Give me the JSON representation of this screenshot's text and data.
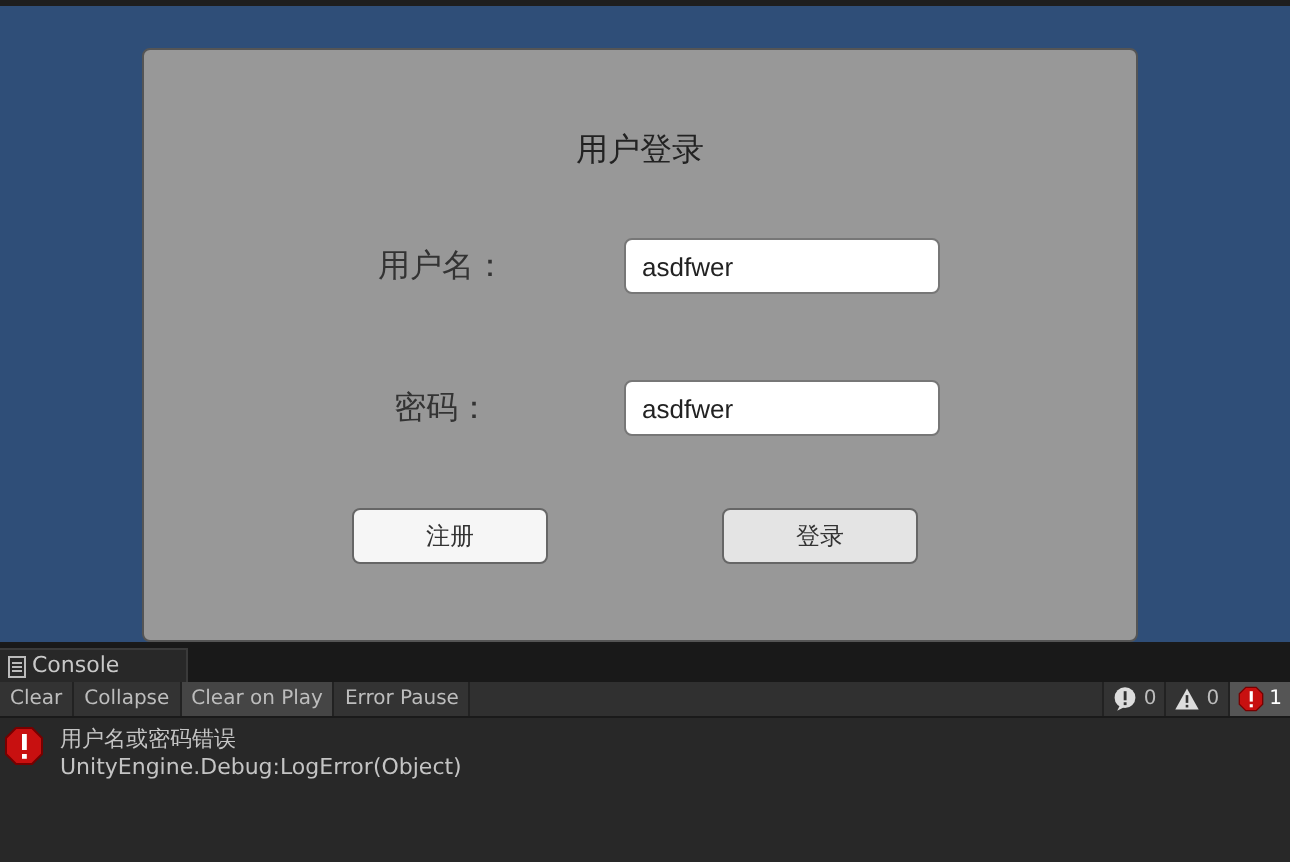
{
  "login": {
    "title": "用户登录",
    "fields": [
      {
        "label": "用户名：",
        "value": "asdfwer"
      },
      {
        "label": "密码：",
        "value": "asdfwer"
      }
    ],
    "buttons": [
      {
        "label": "注册",
        "pressed": false
      },
      {
        "label": "登录",
        "pressed": true
      }
    ]
  },
  "console": {
    "tab": "Console",
    "toolbar": [
      {
        "label": "Clear",
        "selected": false
      },
      {
        "label": "Collapse",
        "selected": false
      },
      {
        "label": "Clear on Play",
        "selected": true
      },
      {
        "label": "Error Pause",
        "selected": false
      }
    ],
    "counters": [
      {
        "kind": "info",
        "count": "0",
        "selected": false
      },
      {
        "kind": "warning",
        "count": "0",
        "selected": false
      },
      {
        "kind": "error",
        "count": "1",
        "selected": true
      }
    ],
    "entries": [
      {
        "kind": "error",
        "message": "用户名或密码错误",
        "trace": "UnityEngine.Debug:LogError(Object)"
      }
    ]
  }
}
